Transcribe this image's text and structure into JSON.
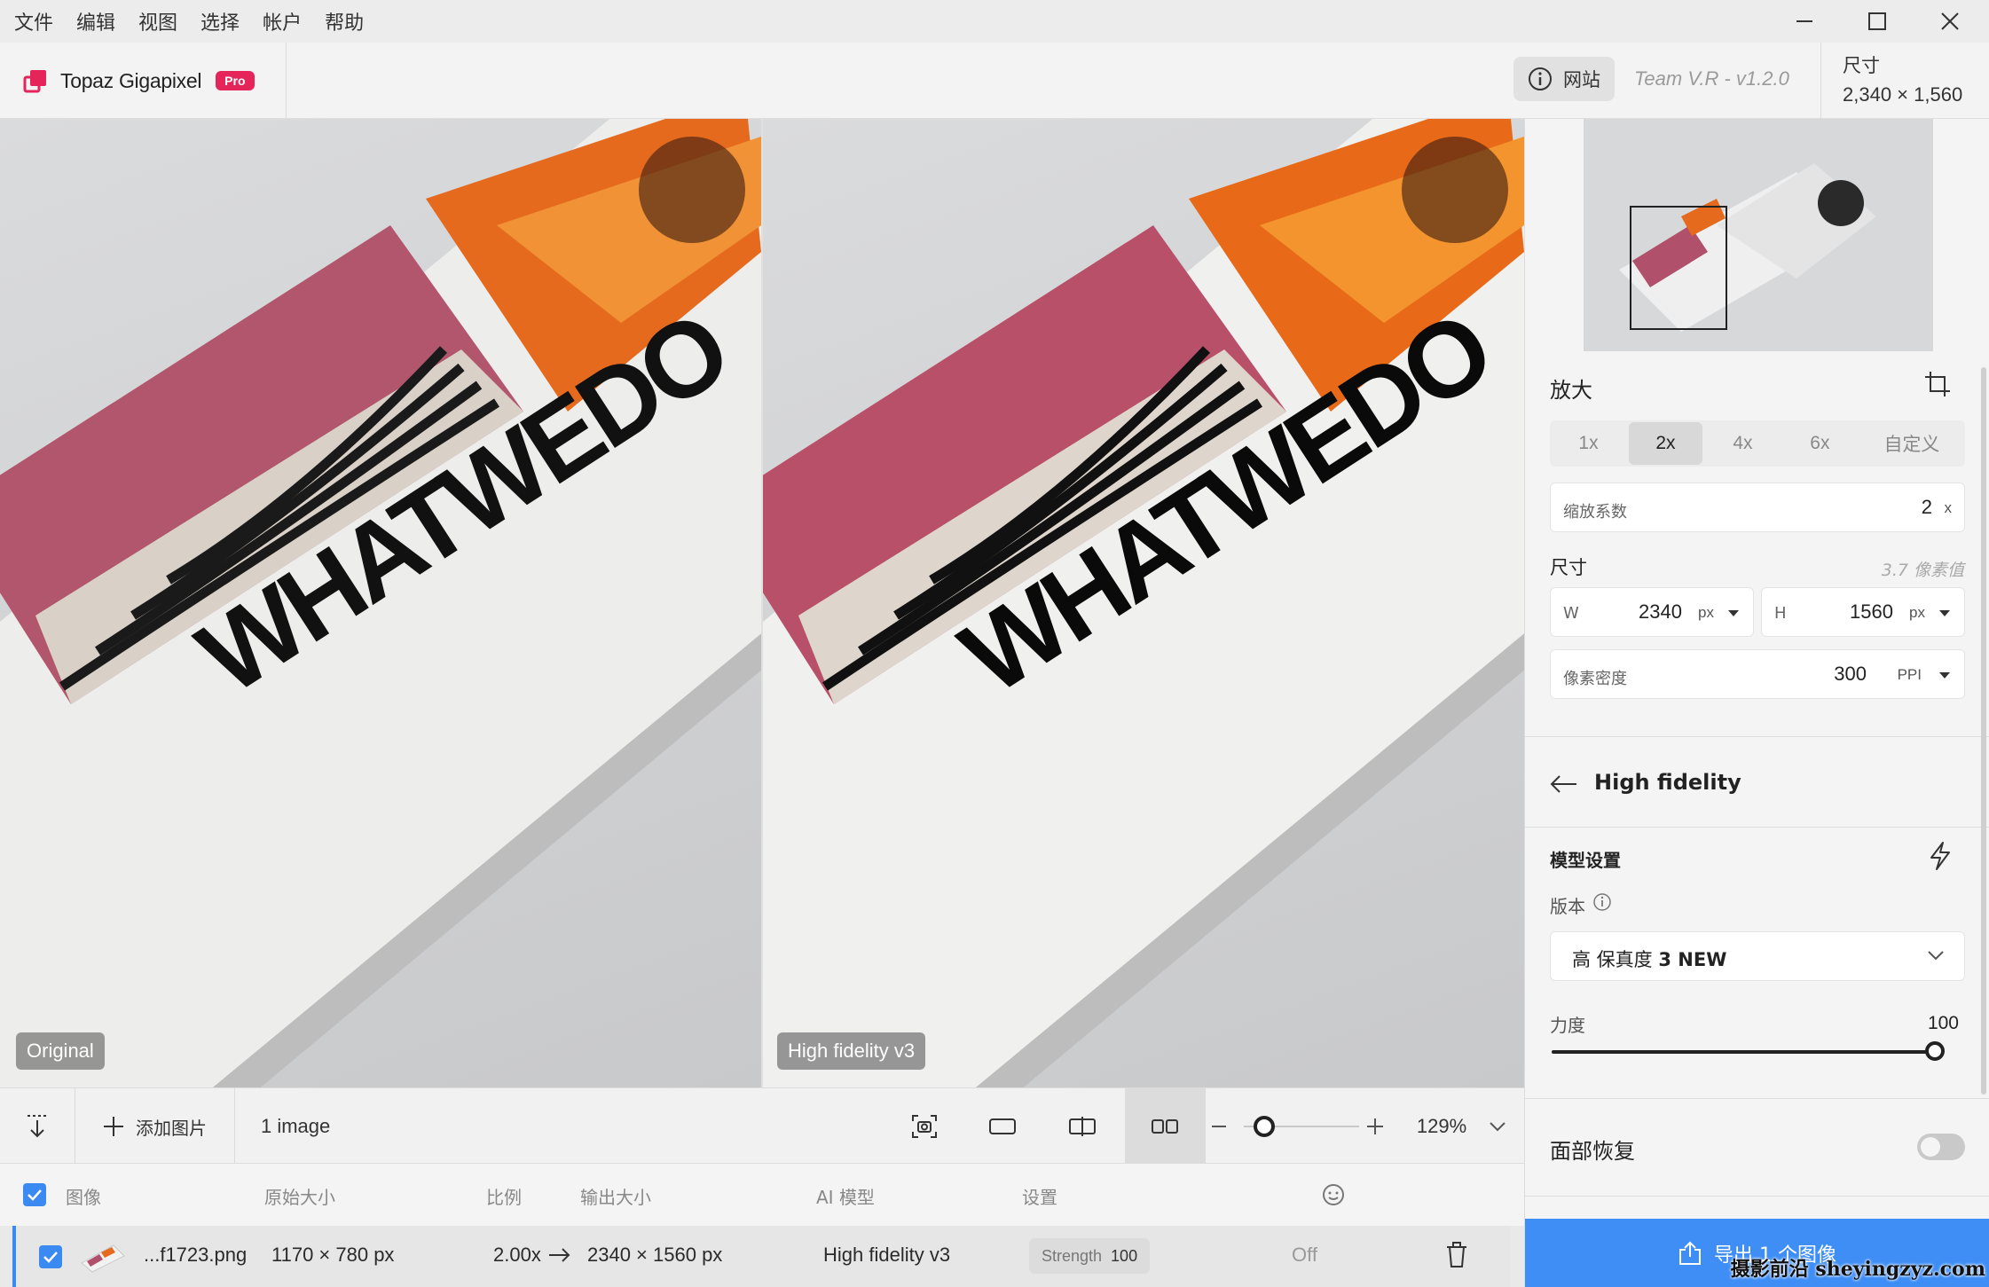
{
  "menu": [
    "文件",
    "编辑",
    "视图",
    "选择",
    "帐户",
    "帮助"
  ],
  "app": {
    "name": "Topaz Gigapixel",
    "badge": "Pro"
  },
  "header": {
    "website_label": "网站",
    "version": "Team V.R -  v1.2.0",
    "dimensions_label": "尺寸",
    "dimensions_value": "2,340 × 1,560"
  },
  "preview": {
    "left_label": "Original",
    "right_label": "High fidelity v3",
    "book_title": "WHATWEDO"
  },
  "toolbar": {
    "add_image": "添加图片",
    "image_count": "1 image",
    "zoom_level": "129%",
    "zoom_fraction": 0.25
  },
  "table": {
    "headers": [
      "图像",
      "原始大小",
      "比例",
      "输出大小",
      "AI 模型",
      "设置"
    ],
    "row": {
      "filename": "...f1723.png",
      "original_size": "1170 × 780 px",
      "ratio": "2.00x",
      "output_size": "2340 × 1560 px",
      "model": "High fidelity v3",
      "strength_label": "Strength",
      "strength_value": "100",
      "face": "Off"
    }
  },
  "sidebar": {
    "upscale_title": "放大",
    "scale_options": [
      "1x",
      "2x",
      "4x",
      "6x",
      "自定义"
    ],
    "scale_active_index": 1,
    "scale_factor_label": "缩放系数",
    "scale_factor_value": "2",
    "scale_factor_unit": "x",
    "size_title": "尺寸",
    "size_hint": "3.7 像素值",
    "width_label": "W",
    "width_value": "2340",
    "width_unit": "px",
    "height_label": "H",
    "height_value": "1560",
    "height_unit": "px",
    "density_label": "像素密度",
    "density_value": "300",
    "density_unit": "PPI",
    "model_back_title": "High fidelity",
    "model_settings_title": "模型设置",
    "version_label": "版本",
    "version_value_prefix": "高 保真度 ",
    "version_value_bold": "3 NEW",
    "strength_label": "力度",
    "strength_value": "100",
    "strength_fraction": 1.0,
    "face_recovery_label": "面部恢复",
    "export_label": "导出 1 个图像"
  },
  "watermark": "摄影前沿 sheyingzyz.com",
  "colors": {
    "accent": "#3f8ef5",
    "pro_badge": "#e5245a"
  }
}
